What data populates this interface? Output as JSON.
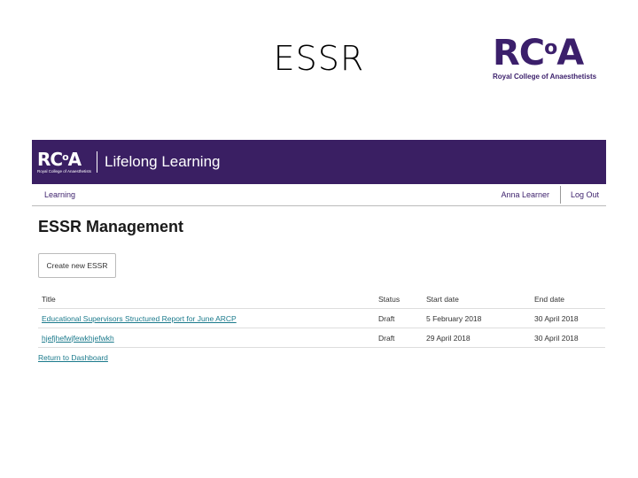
{
  "slide": {
    "title": "ESSR"
  },
  "brand": {
    "logo_text": "RC",
    "logo_o": "o",
    "logo_a": "A",
    "logo_sub": "Royal College of Anaesthetists",
    "color": "#3b1f6b"
  },
  "header": {
    "app_title": "Lifelong Learning",
    "bg": "#3a1f63"
  },
  "nav": {
    "learning": "Learning",
    "user": "Anna Learner",
    "logout": "Log Out"
  },
  "main": {
    "heading": "ESSR Management",
    "create_button": "Create new ESSR",
    "table": {
      "headers": [
        "Title",
        "Status",
        "Start date",
        "End date"
      ],
      "rows": [
        {
          "title": "Educational Supervisors Structured Report for June ARCP",
          "status": "Draft",
          "start": "5 February 2018",
          "end": "30 April 2018"
        },
        {
          "title": "hjefjhefwjfewkhjefwkh",
          "status": "Draft",
          "start": "29 April 2018",
          "end": "30 April 2018"
        }
      ]
    },
    "return_link": "Return to Dashboard"
  }
}
